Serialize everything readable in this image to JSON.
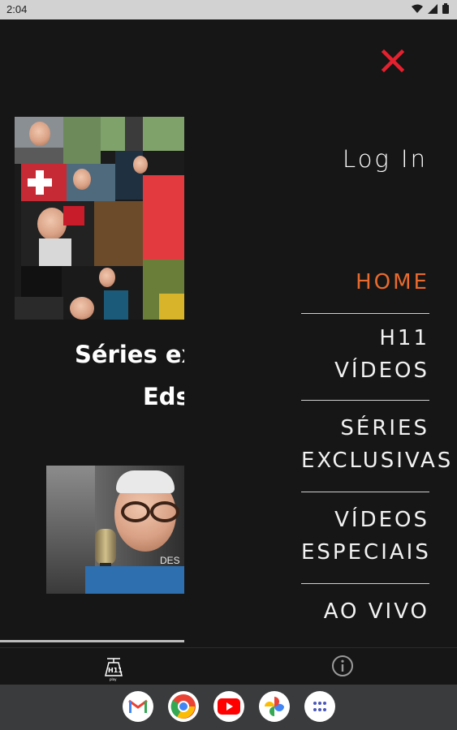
{
  "status_bar": {
    "time": "2:04"
  },
  "content": {
    "title_line1": "Séries ex",
    "title_line2": "Eds"
  },
  "drawer": {
    "login_label": "Log In",
    "menu_items": [
      {
        "label": "HOME",
        "active": true
      },
      {
        "label": "H11 VÍDEOS",
        "active": false
      },
      {
        "label": "SÉRIES EXCLUSIVAS",
        "active": false
      },
      {
        "label": "VÍDEOS ESPECIAIS",
        "active": false
      },
      {
        "label": "AO VIVO",
        "active": false
      }
    ]
  },
  "bottom_nav": {
    "items": [
      "h11-play-logo",
      "info-icon"
    ]
  },
  "taskbar": {
    "apps": [
      "gmail-icon",
      "chrome-icon",
      "youtube-icon",
      "photos-icon",
      "app-drawer-icon"
    ]
  },
  "colors": {
    "accent": "#e86a2e",
    "close": "#e5212f",
    "background": "#161616"
  }
}
